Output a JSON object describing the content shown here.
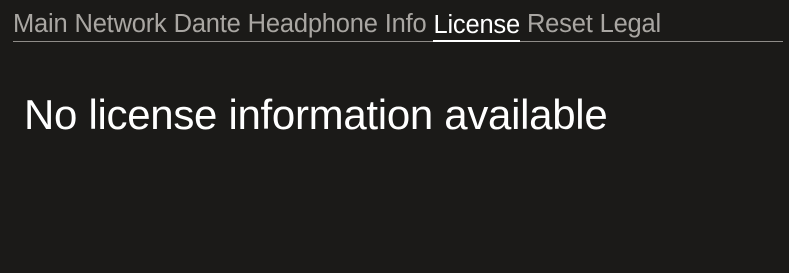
{
  "tabs": [
    {
      "label": "Main",
      "active": false
    },
    {
      "label": "Network",
      "active": false
    },
    {
      "label": "Dante",
      "active": false
    },
    {
      "label": "Headphone",
      "active": false
    },
    {
      "label": "Info",
      "active": false
    },
    {
      "label": "License",
      "active": true
    },
    {
      "label": "Reset",
      "active": false
    },
    {
      "label": "Legal",
      "active": false
    }
  ],
  "content": {
    "message": "No license information available"
  },
  "colors": {
    "background": "#1b1a18",
    "tab_inactive": "#a9a6a2",
    "tab_active": "#ffffff",
    "divider": "#8f8c88",
    "text": "#ffffff"
  }
}
